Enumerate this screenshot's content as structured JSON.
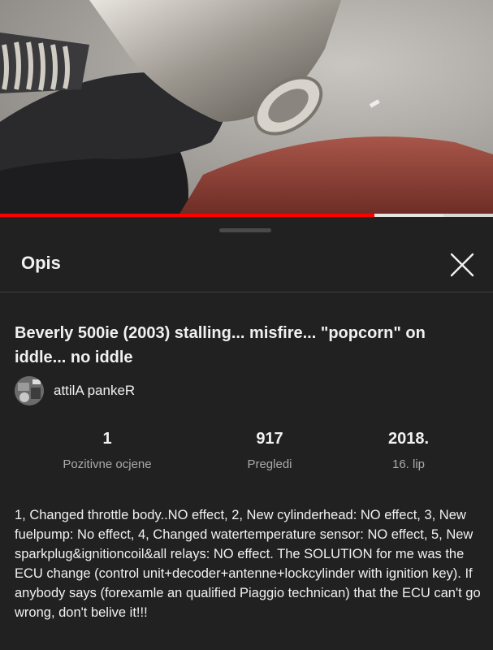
{
  "player": {
    "progress_fraction": 0.76,
    "buffered_fraction": 0.9
  },
  "sheet": {
    "title": "Opis"
  },
  "video": {
    "title": "Beverly 500ie (2003) stalling... misfire... \"popcorn\" on iddle... no iddle",
    "channel": "attilA pankeR"
  },
  "stats": [
    {
      "value": "1",
      "label": "Pozitivne ocjene"
    },
    {
      "value": "917",
      "label": "Pregledi"
    },
    {
      "value": "2018.",
      "label": "16. lip"
    }
  ],
  "description": "1, Changed throttle body..NO effect, 2, New cylinderhead: NO effect, 3, New fuelpump: No effect, 4, Changed watertemperature sensor: NO effect, 5, New sparkplug&ignitioncoil&all relays: NO effect. The SOLUTION for me was the ECU change (control unit+decoder+antenne+lockcylinder with ignition key). If anybody says (forexamle an qualified Piaggio technican) that the ECU can't go wrong, don't belive it!!!",
  "colors": {
    "progress": "#ff0000",
    "background": "#212121",
    "secondary_text": "#aaaaaa"
  },
  "icons": {
    "close": "close-icon"
  }
}
